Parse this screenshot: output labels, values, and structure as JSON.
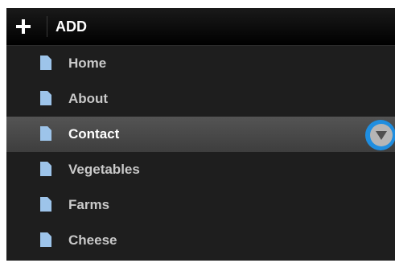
{
  "header": {
    "add_label": "ADD"
  },
  "nav": {
    "items": [
      {
        "label": "Home",
        "icon": "page-icon",
        "selected": false
      },
      {
        "label": "About",
        "icon": "page-icon",
        "selected": false
      },
      {
        "label": "Contact",
        "icon": "page-icon",
        "selected": true
      },
      {
        "label": "Vegetables",
        "icon": "page-icon",
        "selected": false
      },
      {
        "label": "Farms",
        "icon": "page-icon",
        "selected": false
      },
      {
        "label": "Cheese",
        "icon": "page-icon",
        "selected": false
      }
    ]
  },
  "colors": {
    "accent": "#1f8ee0",
    "icon": "#9dc4ea",
    "panel": "#1e1e1e",
    "selected_row": "#4a4a4a"
  }
}
